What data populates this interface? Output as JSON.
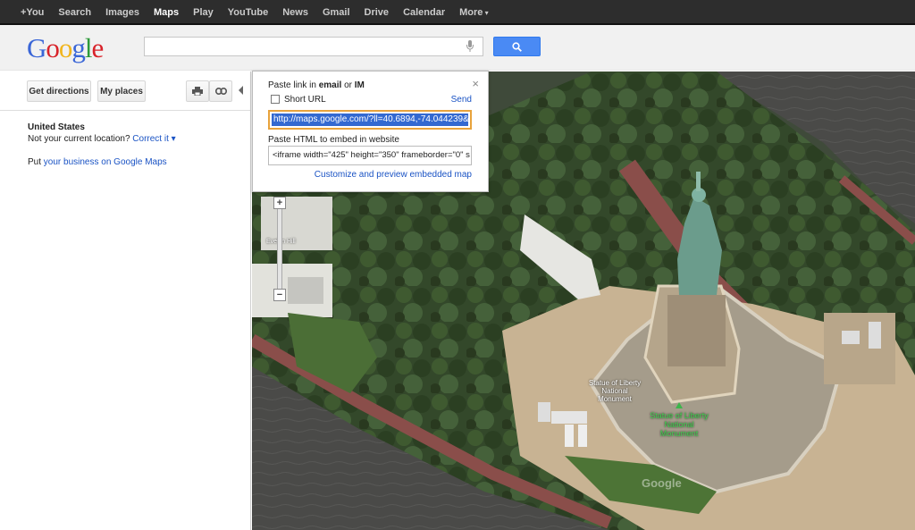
{
  "topnav": {
    "items": [
      "+You",
      "Search",
      "Images",
      "Maps",
      "Play",
      "YouTube",
      "News",
      "Gmail",
      "Drive",
      "Calendar",
      "More"
    ],
    "active": "Maps"
  },
  "header": {
    "logo": {
      "l1": "G",
      "l2": "o",
      "l3": "o",
      "l4": "g",
      "l5": "l",
      "l6": "e"
    },
    "search_value": ""
  },
  "sidebar": {
    "get_directions": "Get directions",
    "my_places": "My places",
    "location_title": "United States",
    "location_prefix": "Not your current location?",
    "correct_it": "Correct it ▾",
    "put_prefix": "Put",
    "put_link": "your business on Google Maps"
  },
  "popup": {
    "paste_link_prefix": "Paste link in",
    "paste_link_email": "email",
    "paste_link_or": "or",
    "paste_link_im": "IM",
    "short_url": "Short URL",
    "send": "Send",
    "url_value": "http://maps.google.com/?ll=40.6894,-74.044239&spn",
    "embed_label": "Paste HTML to embed in website",
    "embed_value": "<iframe width=\"425\" height=\"350\" frameborder=\"0\" s",
    "customize": "Customize and preview embedded map",
    "close": "×"
  },
  "map_labels": {
    "label1": "Statue of Liberty National Monument",
    "label2": "Statue of Liberty National Monument",
    "label3": "Evelyn Hill",
    "watermark": "Google"
  },
  "zoom": {
    "plus": "+",
    "minus": "−"
  },
  "colors": {
    "accent_blue": "#4a8af4",
    "link_blue": "#1a53c4",
    "topbar": "#2d2d2d"
  }
}
